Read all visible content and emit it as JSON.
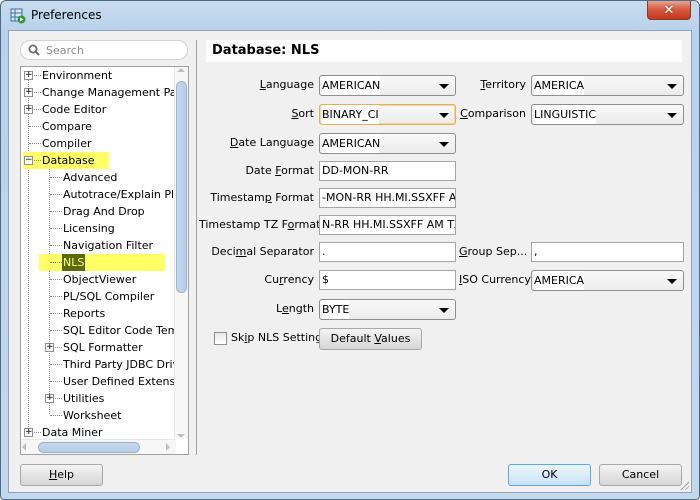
{
  "window": {
    "title": "Preferences",
    "close_glyph": "✕"
  },
  "search": {
    "placeholder": "Search"
  },
  "tree": {
    "items": [
      {
        "label": "Environment",
        "level": 0,
        "expander": "+"
      },
      {
        "label": "Change Management Parar",
        "level": 0,
        "expander": "+"
      },
      {
        "label": "Code Editor",
        "level": 0,
        "expander": "+"
      },
      {
        "label": "Compare",
        "level": 0,
        "expander": ""
      },
      {
        "label": "Compiler",
        "level": 0,
        "expander": ""
      },
      {
        "label": "Database",
        "level": 0,
        "expander": "−",
        "highlighted": true
      },
      {
        "label": "Advanced",
        "level": 1,
        "expander": ""
      },
      {
        "label": "Autotrace/Explain Plan",
        "level": 1,
        "expander": ""
      },
      {
        "label": "Drag And Drop",
        "level": 1,
        "expander": ""
      },
      {
        "label": "Licensing",
        "level": 1,
        "expander": ""
      },
      {
        "label": "Navigation Filter",
        "level": 1,
        "expander": ""
      },
      {
        "label": "NLS",
        "level": 1,
        "expander": "",
        "highlighted": true,
        "selected": true
      },
      {
        "label": "ObjectViewer",
        "level": 1,
        "expander": ""
      },
      {
        "label": "PL/SQL Compiler",
        "level": 1,
        "expander": ""
      },
      {
        "label": "Reports",
        "level": 1,
        "expander": ""
      },
      {
        "label": "SQL Editor Code Templa",
        "level": 1,
        "expander": ""
      },
      {
        "label": "SQL Formatter",
        "level": 1,
        "expander": "+"
      },
      {
        "label": "Third Party JDBC Driver",
        "level": 1,
        "expander": ""
      },
      {
        "label": "User Defined Extension",
        "level": 1,
        "expander": ""
      },
      {
        "label": "Utilities",
        "level": 1,
        "expander": "+"
      },
      {
        "label": "Worksheet",
        "level": 1,
        "expander": ""
      },
      {
        "label": "Data Miner",
        "level": 0,
        "expander": "+"
      }
    ]
  },
  "panel": {
    "title": "Database: NLS",
    "language": {
      "label_pre": "",
      "label_u": "L",
      "label_post": "anguage",
      "value": "AMERICAN"
    },
    "territory": {
      "label_pre": "",
      "label_u": "T",
      "label_post": "erritory",
      "value": "AMERICA"
    },
    "sort": {
      "label_pre": "",
      "label_u": "S",
      "label_post": "ort",
      "value": "BINARY_CI"
    },
    "comparison": {
      "label_pre": "",
      "label_u": "C",
      "label_post": "omparison",
      "value": "LINGUISTIC"
    },
    "date_language": {
      "label_pre": "",
      "label_u": "D",
      "label_post": "ate Language",
      "value": "AMERICAN"
    },
    "date_format": {
      "label_pre": "Date ",
      "label_u": "F",
      "label_post": "ormat",
      "value": "DD-MON-RR"
    },
    "timestamp_format": {
      "label_pre": "Timestam",
      "label_u": "p",
      "label_post": " Format",
      "value": "-MON-RR HH.MI.SSXFF AM"
    },
    "timestamp_tz_format": {
      "label_pre": "Timestamp TZ F",
      "label_u": "o",
      "label_post": "rmat",
      "value": "N-RR HH.MI.SSXFF AM TZR"
    },
    "decimal_separator": {
      "label_pre": "Deci",
      "label_u": "m",
      "label_post": "al Separator",
      "value": "."
    },
    "group_separator": {
      "label_pre": "",
      "label_u": "G",
      "label_post": "roup Sep...",
      "value": ","
    },
    "currency": {
      "label_pre": "Cu",
      "label_u": "r",
      "label_post": "rency",
      "value": "$"
    },
    "iso_currency": {
      "label_pre": "",
      "label_u": "I",
      "label_post": "SO Currency",
      "value": "AMERICA"
    },
    "length": {
      "label_pre": "L",
      "label_u": "e",
      "label_post": "ngth",
      "value": "BYTE"
    },
    "skip_nls": {
      "label_pre": "Sk",
      "label_u": "i",
      "label_post": "p NLS Settings",
      "checked": false
    },
    "default_values": {
      "label_pre": "Default ",
      "label_u": "V",
      "label_post": "alues"
    }
  },
  "footer": {
    "help": {
      "label_pre": "",
      "label_u": "H",
      "label_post": "elp"
    },
    "ok": "OK",
    "cancel": "Cancel"
  }
}
